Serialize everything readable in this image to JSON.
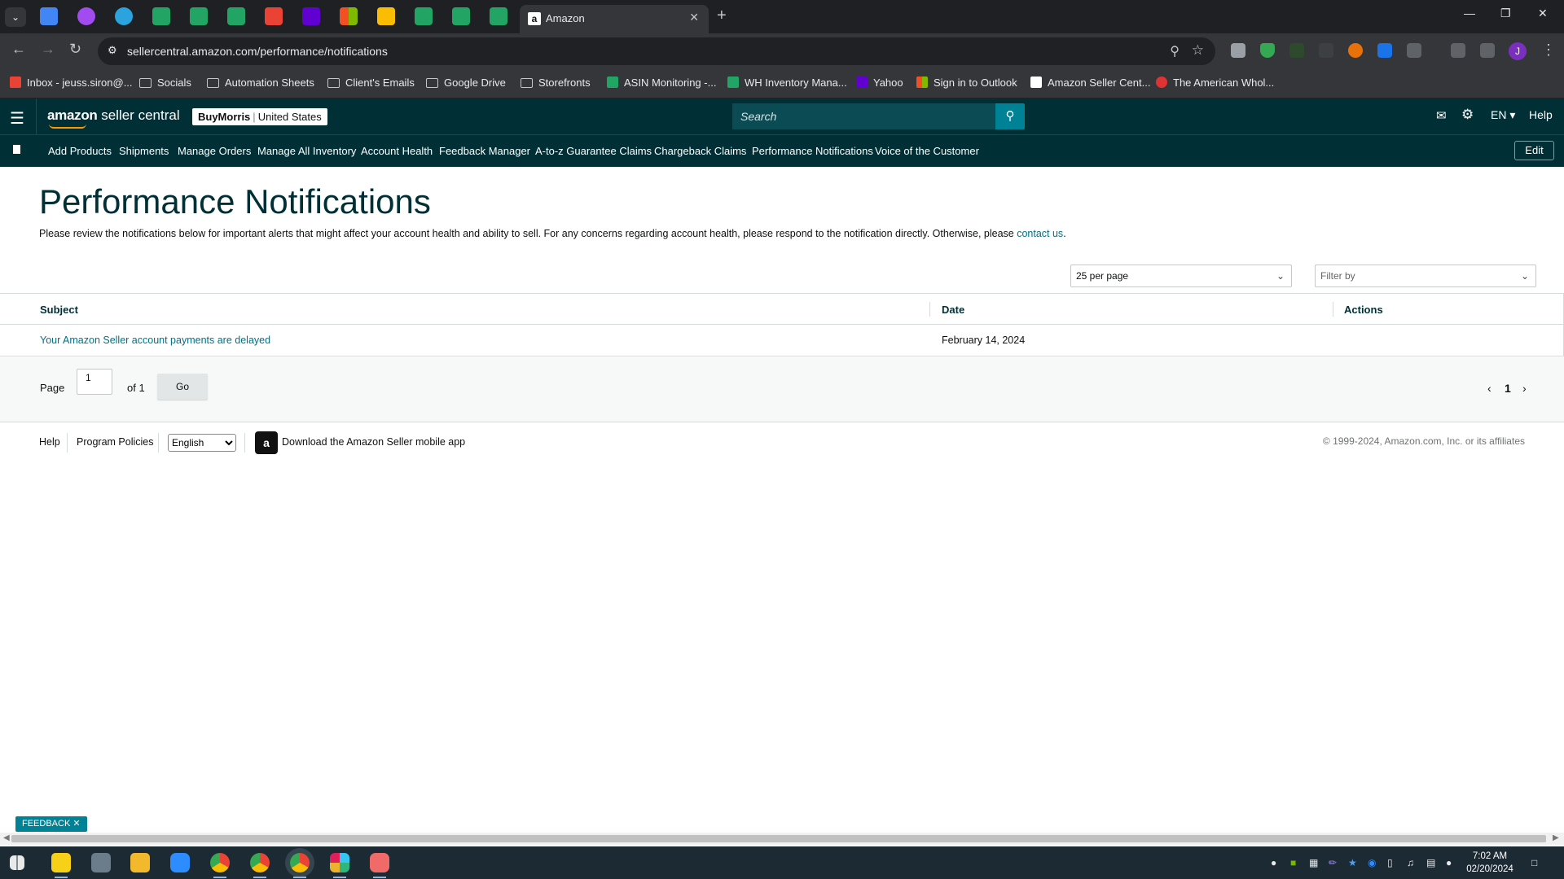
{
  "browser": {
    "active_tab_title": "Amazon",
    "url": "sellercentral.amazon.com/performance/notifications",
    "profile_initial": "J",
    "bookmarks": [
      {
        "label": "Inbox - jeuss.siron@...",
        "icon": "gmail-icon",
        "color": "#ea4335"
      },
      {
        "label": "Socials",
        "icon": "folder-icon",
        "color": ""
      },
      {
        "label": "Automation Sheets",
        "icon": "folder-icon",
        "color": ""
      },
      {
        "label": "Client's Emails",
        "icon": "folder-icon",
        "color": ""
      },
      {
        "label": "Google Drive",
        "icon": "folder-icon",
        "color": ""
      },
      {
        "label": "Storefronts",
        "icon": "folder-icon",
        "color": ""
      },
      {
        "label": "ASIN Monitoring -...",
        "icon": "sheets-icon",
        "color": "#21a464"
      },
      {
        "label": "WH Inventory Mana...",
        "icon": "sheets-icon",
        "color": "#21a464"
      },
      {
        "label": "Yahoo",
        "icon": "yahoo-icon",
        "color": "#6001d2"
      },
      {
        "label": "Sign in to Outlook",
        "icon": "microsoft-icon",
        "color": "#f25022"
      },
      {
        "label": "Amazon Seller Cent...",
        "icon": "amazon-icon",
        "color": "#ffffff"
      },
      {
        "label": "The American Whol...",
        "icon": "site-icon",
        "color": "#d33"
      }
    ]
  },
  "header": {
    "brand_amazon": "amazon",
    "brand_rest": " seller central",
    "store_name": "BuyMorris",
    "store_country": "United States",
    "search_placeholder": "Search",
    "lang": "EN ▾",
    "help": "Help"
  },
  "nav": {
    "items": [
      "Add Products",
      "Shipments",
      "Manage Orders",
      "Manage All Inventory",
      "Account Health",
      "Feedback Manager",
      "A-to-z Guarantee Claims",
      "Chargeback Claims",
      "Performance Notifications",
      "Voice of the Customer"
    ],
    "edit": "Edit"
  },
  "page": {
    "title": "Performance Notifications",
    "intro": "Please review the notifications below for important alerts that might affect your account health and ability to sell. For any concerns regarding account health, please respond to the notification directly. Otherwise, please ",
    "contact_link": "contact us",
    "intro_end": ".",
    "per_page": "25 per page",
    "filter_placeholder": "Filter by"
  },
  "table": {
    "columns": [
      "Subject",
      "Date",
      "Actions"
    ],
    "rows": [
      {
        "subject": "Your Amazon Seller account payments are delayed",
        "date": "February 14, 2024",
        "actions": ""
      }
    ]
  },
  "pager": {
    "page_label": "Page",
    "page_value": "1",
    "of_label": "of 1",
    "go": "Go",
    "current": "1"
  },
  "footer": {
    "help": "Help",
    "program_policies": "Program Policies",
    "language": "English",
    "app_text": "Download the Amazon Seller mobile app",
    "copyright": "© 1999-2024, Amazon.com, Inc. or its affiliates"
  },
  "feedback": "FEEDBACK ✕",
  "taskbar": {
    "time": "7:02 AM",
    "date": "02/20/2024"
  }
}
